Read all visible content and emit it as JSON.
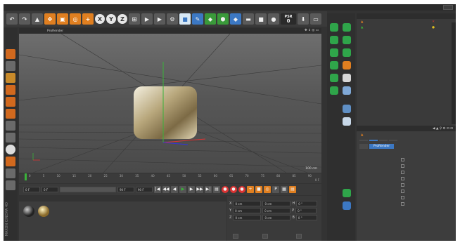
{
  "app": {
    "name": "CINEMA 4D",
    "brand": "MAXON"
  },
  "menubar": {
    "items": [
      "",
      "",
      "",
      "",
      "",
      "",
      "",
      "",
      "",
      "",
      "",
      "",
      "",
      "",
      "",
      "",
      "",
      "",
      ""
    ]
  },
  "layout": {
    "label": "",
    "value": ""
  },
  "toolbar": {
    "psr_label": "PSR",
    "psr_value": "0"
  },
  "viewport": {
    "menu": [
      "",
      "",
      "",
      "",
      "",
      "",
      "ProRender"
    ],
    "label": "",
    "grid_info": "100 cm"
  },
  "timeline": {
    "ticks": [
      "0",
      "5",
      "10",
      "15",
      "20",
      "25",
      "30",
      "35",
      "40",
      "45",
      "50",
      "55",
      "60",
      "65",
      "70",
      "75",
      "80",
      "85",
      "90"
    ],
    "end_frame": "0 F"
  },
  "playback": {
    "start": "0 F",
    "current": "0 F",
    "end": "90 F",
    "end2": "90 F"
  },
  "material": {
    "menu": [
      "",
      "",
      "",
      ""
    ],
    "items": [
      {
        "label": ""
      },
      {
        "label": ""
      }
    ]
  },
  "coords": {
    "headers": [
      "",
      "",
      ""
    ],
    "rows": [
      {
        "axis": "X",
        "pos": "0 cm",
        "size": "0 cm",
        "rot_axis": "H",
        "rot": "0 °"
      },
      {
        "axis": "Y",
        "pos": "0 cm",
        "size": "0 cm",
        "rot_axis": "P",
        "rot": "0 °"
      },
      {
        "axis": "Z",
        "pos": "0 cm",
        "size": "0 cm",
        "rot_axis": "B",
        "rot": "0 °"
      }
    ],
    "btn_object": "",
    "btn_size": "",
    "btn_apply": ""
  },
  "objects": {
    "menu": [
      "",
      "",
      "",
      "",
      "",
      ""
    ],
    "rows": [
      {
        "name": ""
      },
      {
        "name": ""
      }
    ]
  },
  "attributes": {
    "menu": [
      "",
      "",
      ""
    ],
    "title": "",
    "tabs": [
      "",
      "",
      "",
      ""
    ],
    "subtabs": [
      "",
      "ProRender"
    ],
    "section": "",
    "rows": [
      {
        "left": "",
        "right": ""
      },
      {
        "left": "",
        "right": ""
      },
      {
        "left": "",
        "right": ""
      },
      {
        "left": "",
        "right": ""
      },
      {
        "left": "",
        "right": ""
      },
      {
        "left": "",
        "right": ""
      },
      {
        "left": "",
        "right": ""
      },
      {
        "left": "",
        "right": ""
      }
    ],
    "extra": ""
  },
  "colors": {
    "accent_orange": "#e07f20",
    "accent_blue": "#3c78c3",
    "green_tool": "#2fa54a",
    "bg_dark": "#333333"
  }
}
